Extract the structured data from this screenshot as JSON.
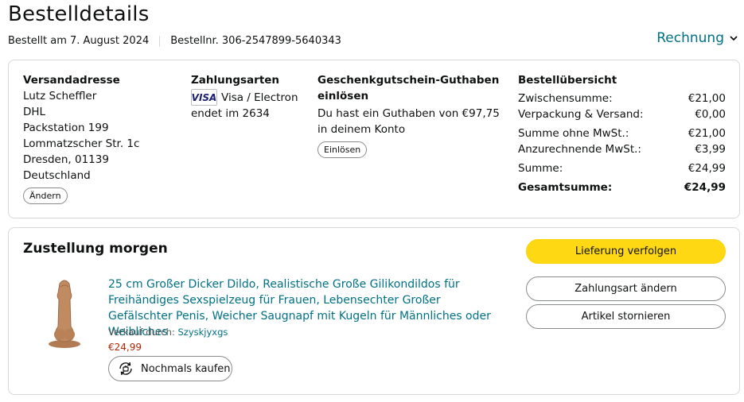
{
  "header": {
    "title": "Bestelldetails",
    "ordered_on": "Bestellt am 7. August 2024",
    "order_number": "Bestellnr. 306-2547899-5640343",
    "invoice_label": "Rechnung"
  },
  "summary_box": {
    "shipping": {
      "heading": "Versandadresse",
      "lines": [
        "Lutz Scheffler",
        "DHL",
        "Packstation 199",
        "Lommatzscher Str. 1c",
        "Dresden, 01139",
        "Deutschland"
      ],
      "change_label": "Ändern"
    },
    "payment": {
      "heading": "Zahlungsarten",
      "card_brand": "VISA",
      "card_type": "Visa / Electron",
      "card_ending": "endet im 2634"
    },
    "gift_card": {
      "heading": "Geschenkgutschein-Guthaben einlösen",
      "text": "Du hast ein Guthaben von €97,75 in deinem Konto",
      "redeem_label": "Einlösen"
    },
    "overview": {
      "heading": "Bestellübersicht",
      "rows": [
        {
          "label": "Zwischensumme:",
          "value": "€21,00"
        },
        {
          "label": "Verpackung & Versand:",
          "value": "€0,00"
        },
        {
          "label": "Summe ohne MwSt.:",
          "value": "€21,00"
        },
        {
          "label": "Anzurechnende MwSt.:",
          "value": "€3,99"
        },
        {
          "label": "Summe:",
          "value": "€24,99"
        },
        {
          "label": "Gesamtsumme:",
          "value": "€24,99"
        }
      ]
    }
  },
  "delivery": {
    "heading": "Zustellung morgen",
    "product_title": "25 cm Großer Dicker Dildo, Realistische Große Gilikondildos für Freihändiges Sexspielzeug für Frauen, Lebensechter Großer Gefälschter Penis, Weicher Saugnapf mit Kugeln für Männliches oder Weibliches",
    "seller_prefix": "Verkauf durch:",
    "seller_name": "Szyskjyxgs",
    "price": "€24,99",
    "rebuy_label": "Nochmals kaufen",
    "track_label": "Lieferung verfolgen",
    "change_payment_label": "Zahlungsart ändern",
    "cancel_label": "Artikel stornieren"
  },
  "colors": {
    "link": "#007185",
    "price": "#b12704",
    "primary_button": "#ffd814",
    "border": "#d5d9d9"
  }
}
